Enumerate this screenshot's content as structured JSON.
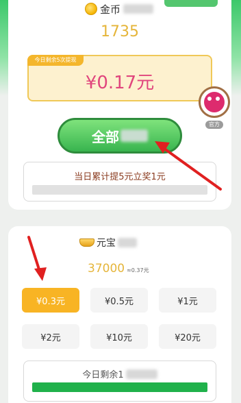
{
  "header": {
    "coin_title": "金币",
    "icon": "gold-coin-icon"
  },
  "coin_balance": "1735",
  "withdraw": {
    "badge": "今日剩余5次提现",
    "amount": "¥0.17元",
    "button_label": "全部",
    "reward_text": "当日累计提5元立奖1元"
  },
  "side_badge": {
    "label": "官方",
    "icon": "official-avatar-icon"
  },
  "yuanbao": {
    "title": "元宝",
    "icon": "yuanbao-icon",
    "count": "37000",
    "count_sub": "≈0.37元",
    "options": [
      "¥0.3元",
      "¥0.5元",
      "¥1元",
      "¥2元",
      "¥10元",
      "¥20元"
    ],
    "selected_index": 0,
    "remaining_text": "今日剩余1"
  },
  "colors": {
    "accent_green": "#38b44f",
    "gold": "#e5b53a",
    "pink": "#e0457d",
    "selected": "#f8b424",
    "arrow": "#e02020"
  }
}
